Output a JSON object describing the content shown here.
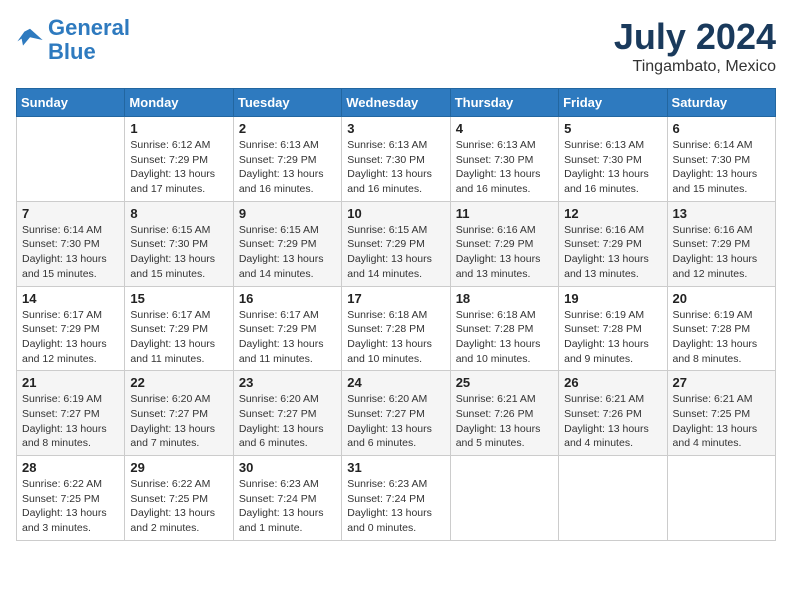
{
  "header": {
    "logo_line1": "General",
    "logo_line2": "Blue",
    "month": "July 2024",
    "location": "Tingambato, Mexico"
  },
  "days_of_week": [
    "Sunday",
    "Monday",
    "Tuesday",
    "Wednesday",
    "Thursday",
    "Friday",
    "Saturday"
  ],
  "weeks": [
    [
      {
        "day": "",
        "info": ""
      },
      {
        "day": "1",
        "info": "Sunrise: 6:12 AM\nSunset: 7:29 PM\nDaylight: 13 hours\nand 17 minutes."
      },
      {
        "day": "2",
        "info": "Sunrise: 6:13 AM\nSunset: 7:29 PM\nDaylight: 13 hours\nand 16 minutes."
      },
      {
        "day": "3",
        "info": "Sunrise: 6:13 AM\nSunset: 7:30 PM\nDaylight: 13 hours\nand 16 minutes."
      },
      {
        "day": "4",
        "info": "Sunrise: 6:13 AM\nSunset: 7:30 PM\nDaylight: 13 hours\nand 16 minutes."
      },
      {
        "day": "5",
        "info": "Sunrise: 6:13 AM\nSunset: 7:30 PM\nDaylight: 13 hours\nand 16 minutes."
      },
      {
        "day": "6",
        "info": "Sunrise: 6:14 AM\nSunset: 7:30 PM\nDaylight: 13 hours\nand 15 minutes."
      }
    ],
    [
      {
        "day": "7",
        "info": "Sunrise: 6:14 AM\nSunset: 7:30 PM\nDaylight: 13 hours\nand 15 minutes."
      },
      {
        "day": "8",
        "info": "Sunrise: 6:15 AM\nSunset: 7:30 PM\nDaylight: 13 hours\nand 15 minutes."
      },
      {
        "day": "9",
        "info": "Sunrise: 6:15 AM\nSunset: 7:29 PM\nDaylight: 13 hours\nand 14 minutes."
      },
      {
        "day": "10",
        "info": "Sunrise: 6:15 AM\nSunset: 7:29 PM\nDaylight: 13 hours\nand 14 minutes."
      },
      {
        "day": "11",
        "info": "Sunrise: 6:16 AM\nSunset: 7:29 PM\nDaylight: 13 hours\nand 13 minutes."
      },
      {
        "day": "12",
        "info": "Sunrise: 6:16 AM\nSunset: 7:29 PM\nDaylight: 13 hours\nand 13 minutes."
      },
      {
        "day": "13",
        "info": "Sunrise: 6:16 AM\nSunset: 7:29 PM\nDaylight: 13 hours\nand 12 minutes."
      }
    ],
    [
      {
        "day": "14",
        "info": "Sunrise: 6:17 AM\nSunset: 7:29 PM\nDaylight: 13 hours\nand 12 minutes."
      },
      {
        "day": "15",
        "info": "Sunrise: 6:17 AM\nSunset: 7:29 PM\nDaylight: 13 hours\nand 11 minutes."
      },
      {
        "day": "16",
        "info": "Sunrise: 6:17 AM\nSunset: 7:29 PM\nDaylight: 13 hours\nand 11 minutes."
      },
      {
        "day": "17",
        "info": "Sunrise: 6:18 AM\nSunset: 7:28 PM\nDaylight: 13 hours\nand 10 minutes."
      },
      {
        "day": "18",
        "info": "Sunrise: 6:18 AM\nSunset: 7:28 PM\nDaylight: 13 hours\nand 10 minutes."
      },
      {
        "day": "19",
        "info": "Sunrise: 6:19 AM\nSunset: 7:28 PM\nDaylight: 13 hours\nand 9 minutes."
      },
      {
        "day": "20",
        "info": "Sunrise: 6:19 AM\nSunset: 7:28 PM\nDaylight: 13 hours\nand 8 minutes."
      }
    ],
    [
      {
        "day": "21",
        "info": "Sunrise: 6:19 AM\nSunset: 7:27 PM\nDaylight: 13 hours\nand 8 minutes."
      },
      {
        "day": "22",
        "info": "Sunrise: 6:20 AM\nSunset: 7:27 PM\nDaylight: 13 hours\nand 7 minutes."
      },
      {
        "day": "23",
        "info": "Sunrise: 6:20 AM\nSunset: 7:27 PM\nDaylight: 13 hours\nand 6 minutes."
      },
      {
        "day": "24",
        "info": "Sunrise: 6:20 AM\nSunset: 7:27 PM\nDaylight: 13 hours\nand 6 minutes."
      },
      {
        "day": "25",
        "info": "Sunrise: 6:21 AM\nSunset: 7:26 PM\nDaylight: 13 hours\nand 5 minutes."
      },
      {
        "day": "26",
        "info": "Sunrise: 6:21 AM\nSunset: 7:26 PM\nDaylight: 13 hours\nand 4 minutes."
      },
      {
        "day": "27",
        "info": "Sunrise: 6:21 AM\nSunset: 7:25 PM\nDaylight: 13 hours\nand 4 minutes."
      }
    ],
    [
      {
        "day": "28",
        "info": "Sunrise: 6:22 AM\nSunset: 7:25 PM\nDaylight: 13 hours\nand 3 minutes."
      },
      {
        "day": "29",
        "info": "Sunrise: 6:22 AM\nSunset: 7:25 PM\nDaylight: 13 hours\nand 2 minutes."
      },
      {
        "day": "30",
        "info": "Sunrise: 6:23 AM\nSunset: 7:24 PM\nDaylight: 13 hours\nand 1 minute."
      },
      {
        "day": "31",
        "info": "Sunrise: 6:23 AM\nSunset: 7:24 PM\nDaylight: 13 hours\nand 0 minutes."
      },
      {
        "day": "",
        "info": ""
      },
      {
        "day": "",
        "info": ""
      },
      {
        "day": "",
        "info": ""
      }
    ]
  ]
}
